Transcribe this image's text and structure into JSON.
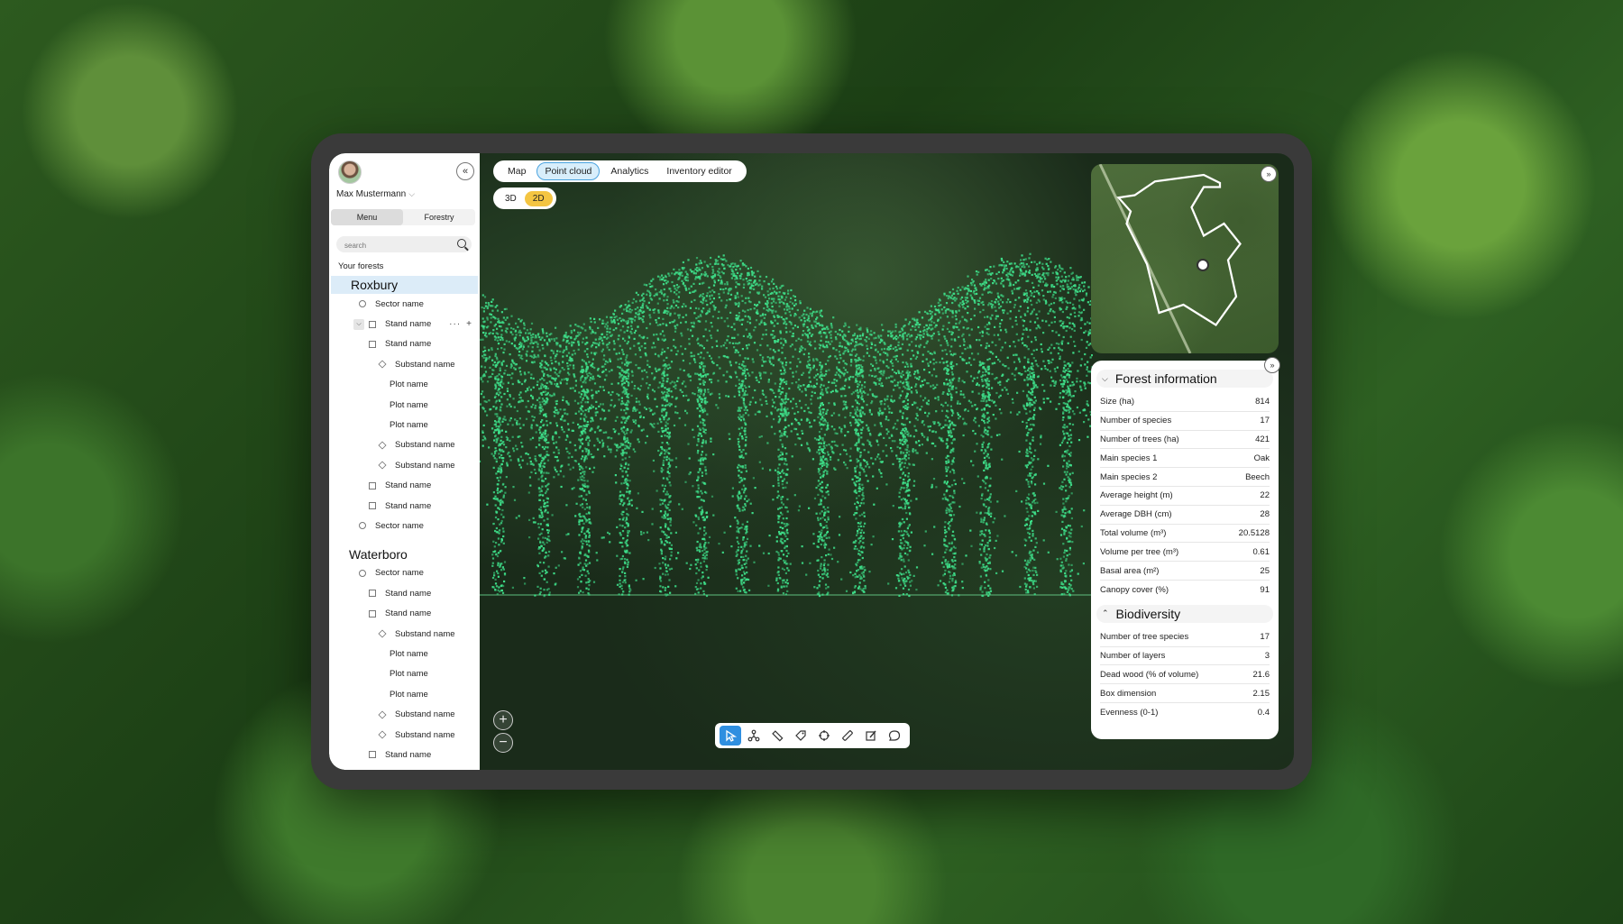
{
  "user": {
    "name": "Max Mustermann"
  },
  "sidebar": {
    "collapse_label": "«",
    "tabs": [
      "Menu",
      "Forestry"
    ],
    "search_placeholder": "search",
    "section_label": "Your forests",
    "forests": [
      {
        "name": "Roxbury",
        "items": [
          {
            "label": "Sector name",
            "type": "sector"
          },
          {
            "label": "Stand name",
            "type": "stand-expanded"
          },
          {
            "label": "Stand name",
            "type": "stand-sub"
          },
          {
            "label": "Substand name",
            "type": "substand"
          },
          {
            "label": "Plot name",
            "type": "plot"
          },
          {
            "label": "Plot name",
            "type": "plot"
          },
          {
            "label": "Plot name",
            "type": "plot"
          },
          {
            "label": "Substand name",
            "type": "substand"
          },
          {
            "label": "Substand name",
            "type": "substand"
          },
          {
            "label": "Stand name",
            "type": "stand-sub"
          },
          {
            "label": "Stand name",
            "type": "stand-sub"
          },
          {
            "label": "Sector name",
            "type": "sector"
          }
        ]
      },
      {
        "name": "Waterboro",
        "items": [
          {
            "label": "Sector name",
            "type": "sector"
          },
          {
            "label": "Stand name",
            "type": "stand-sub"
          },
          {
            "label": "Stand name",
            "type": "stand-sub"
          },
          {
            "label": "Substand name",
            "type": "substand"
          },
          {
            "label": "Plot name",
            "type": "plot"
          },
          {
            "label": "Plot name",
            "type": "plot"
          },
          {
            "label": "Plot name",
            "type": "plot"
          },
          {
            "label": "Substand name",
            "type": "substand"
          },
          {
            "label": "Substand name",
            "type": "substand"
          },
          {
            "label": "Stand name",
            "type": "stand-sub"
          }
        ]
      }
    ]
  },
  "top_tabs": [
    "Map",
    "Point cloud",
    "Analytics",
    "Inventory editor"
  ],
  "active_top_tab": "Point cloud",
  "view_modes": [
    "3D",
    "2D"
  ],
  "active_view_mode": "2D",
  "forest_information": {
    "title": "Forest information",
    "rows": [
      {
        "label": "Size (ha)",
        "value": "814"
      },
      {
        "label": "Number of species",
        "value": "17"
      },
      {
        "label": "Number of trees (ha)",
        "value": "421"
      },
      {
        "label": "Main species 1",
        "value": "Oak"
      },
      {
        "label": "Main species 2",
        "value": "Beech"
      },
      {
        "label": "Average height (m)",
        "value": "22"
      },
      {
        "label": "Average DBH (cm)",
        "value": "28"
      },
      {
        "label": "Total volume (m³)",
        "value": "20.5128"
      },
      {
        "label": "Volume per tree (m³)",
        "value": "0.61"
      },
      {
        "label": "Basal area (m²)",
        "value": "25"
      },
      {
        "label": "Canopy cover (%)",
        "value": "91"
      }
    ]
  },
  "biodiversity": {
    "title": "Biodiversity",
    "rows": [
      {
        "label": "Number of tree species",
        "value": "17"
      },
      {
        "label": "Number of layers",
        "value": "3"
      },
      {
        "label": "Dead wood (% of volume)",
        "value": "21.6"
      },
      {
        "label": "Box dimension",
        "value": "2.15"
      },
      {
        "label": "Evenness (0-1)",
        "value": "0.4"
      }
    ]
  },
  "toolbar": [
    "select-icon",
    "node-icon",
    "ruler-icon",
    "tag-icon",
    "target-icon",
    "measure-icon",
    "edit-icon",
    "comment-icon"
  ],
  "colors": {
    "accent": "#2f8fe0",
    "point_cloud": "#3ee08a",
    "toggle_active": "#f4c542",
    "tab_active_border": "#4aa3df"
  }
}
